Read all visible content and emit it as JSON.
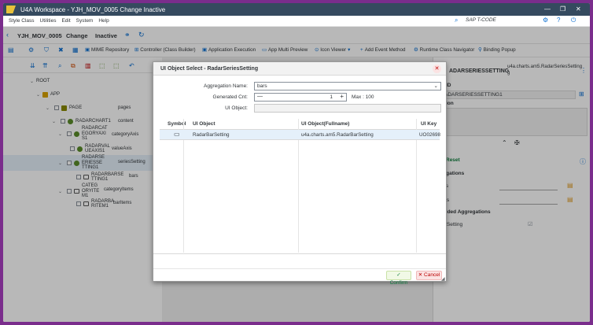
{
  "window": {
    "title": "U4A Workspace - YJH_MOV_0005 Change Inactive"
  },
  "menu": {
    "items": [
      "Style Class",
      "Utilities",
      "Edit",
      "System",
      "Help"
    ],
    "sap_tcode": "SAP T-CODE"
  },
  "infobar": {
    "app_id": "YJH_MOV_0005",
    "mode": "Change",
    "status": "Inactive"
  },
  "toolbar": {
    "items": [
      "MIME Repository",
      "Controller (Class Builder)",
      "Application Execution",
      "App Multi Preview",
      "Icon Viewer",
      "Add Event Method",
      "Runtime Class Navigator",
      "Binding Popup"
    ]
  },
  "tree": {
    "root": "ROOT",
    "app": "APP",
    "page": "PAGE",
    "page_agg": "pages",
    "radarchart": "RADARCHART1",
    "radarchart_agg": "content",
    "category_axis": [
      "RADARCAT",
      "EGORYAXI",
      "S1"
    ],
    "category_axis_agg": "categoryAxis",
    "value_axis": [
      "RADARVAL",
      "UEAXIS1"
    ],
    "value_axis_agg": "valueAxis",
    "series": [
      "RADARSE",
      "ERIESSE",
      "TTING1"
    ],
    "series_agg": "seriesSetting",
    "bar_setting": [
      "RADARBARSE",
      "TTING1"
    ],
    "bar_setting_agg": "bars",
    "category_items": [
      "CATEG",
      "ORYITE",
      "M1"
    ],
    "category_items_agg": "categoryItems",
    "bar_item": [
      "RADARBA",
      "RITEM1"
    ],
    "bar_item_agg": "barItems"
  },
  "right_panel": {
    "title_line1": "ADARSERIESSETTING",
    "class_line1": "u4a.charts.am5.RadarSeriesSetting",
    "class_line2": "g",
    "id_label": "t ID",
    "id_value": "ADARSERIESSETTING1",
    "desc_label": "ition",
    "reset_label": "Reset",
    "aggregations_label": "regations",
    "agg_row1": "ars",
    "agg_row2": "ses",
    "embedded_label": "edded Aggregations",
    "embedded_row": "esSetting"
  },
  "dialog": {
    "title": "UI Object Select - RadarSeriesSetting",
    "aggregation_name_label": "Aggregation Name:",
    "aggregation_name_value": "bars",
    "generated_cnt_label": "Generated Cnt:",
    "generated_cnt_value": "1",
    "max_label": "Max : 100",
    "ui_object_label": "UI Object:",
    "table_headers": {
      "symbol": "Symbol",
      "ui_object": "UI Object",
      "full_name": "UI Object(Fullname)",
      "ui_key": "UI Key"
    },
    "rows": [
      {
        "ui_object": "RadarBarSetting",
        "full_name": "u4a.charts.am5.RadarBarSetting",
        "ui_key": "UO02698"
      }
    ],
    "confirm_label": "Confirm",
    "cancel_label": "Cancel"
  },
  "colors": {
    "shell": "#354a5f",
    "accent": "#0a6ed1",
    "border_frame": "#7a2d8c",
    "confirm_bg": "#f1f9e6",
    "cancel_bg": "#fbe3e3"
  }
}
